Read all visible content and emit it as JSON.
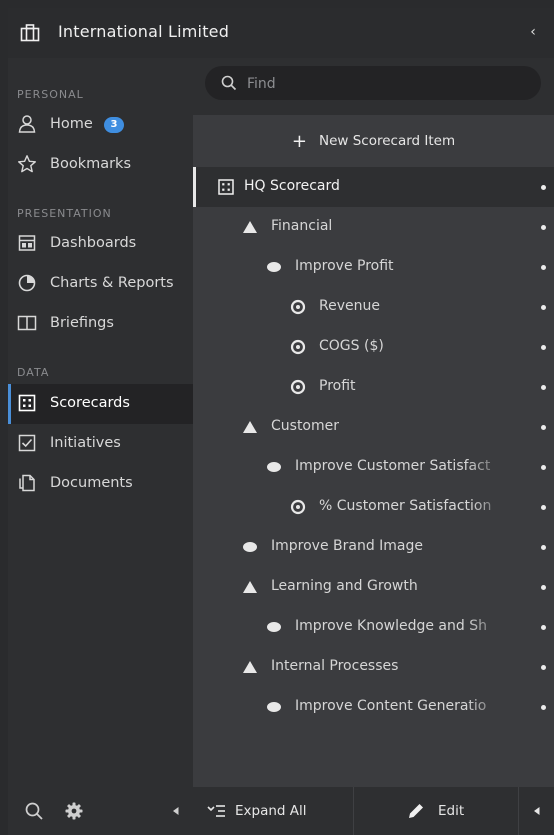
{
  "header": {
    "org_name": "International Limited",
    "org_icon": "briefcase-icon",
    "collapse_icon": "chevron-left-icon"
  },
  "sidebar": {
    "sections": [
      {
        "label": "PERSONAL"
      },
      {
        "label": "PRESENTATION"
      },
      {
        "label": "DATA"
      }
    ],
    "items": [
      {
        "label": "Home",
        "icon": "home-icon",
        "badge": "3"
      },
      {
        "label": "Bookmarks",
        "icon": "star-icon"
      },
      {
        "label": "Dashboards",
        "icon": "dashboard-icon"
      },
      {
        "label": "Charts & Reports",
        "icon": "pie-chart-icon"
      },
      {
        "label": "Briefings",
        "icon": "book-icon"
      },
      {
        "label": "Scorecards",
        "icon": "scorecard-icon",
        "active": true
      },
      {
        "label": "Initiatives",
        "icon": "checkbox-icon"
      },
      {
        "label": "Documents",
        "icon": "documents-icon"
      }
    ],
    "footer": {
      "search_icon": "search-icon",
      "settings_icon": "gear-icon",
      "collapse_icon": "triangle-left-icon"
    }
  },
  "main": {
    "search": {
      "placeholder": "Find"
    },
    "new_item_label": "New Scorecard Item",
    "tree": [
      {
        "label": "HQ Scorecard",
        "icon": "scorecard-icon",
        "level": 0
      },
      {
        "label": "Financial",
        "icon": "triangle-icon",
        "level": 1
      },
      {
        "label": "Improve Profit",
        "icon": "ellipse-icon",
        "level": 2
      },
      {
        "label": "Revenue",
        "icon": "target-icon",
        "level": 3
      },
      {
        "label": "COGS ($)",
        "icon": "target-icon",
        "level": 3
      },
      {
        "label": "Profit",
        "icon": "target-icon",
        "level": 3
      },
      {
        "label": "Customer",
        "icon": "triangle-icon",
        "level": 1
      },
      {
        "label": "Improve Customer Satisfact",
        "icon": "ellipse-icon",
        "level": 2
      },
      {
        "label": "% Customer Satisfaction",
        "icon": "target-icon",
        "level": 3
      },
      {
        "label": "Improve Brand Image",
        "icon": "ellipse-icon",
        "level": 1
      },
      {
        "label": "Learning and Growth",
        "icon": "triangle-icon",
        "level": 1
      },
      {
        "label": "Improve Knowledge and Sh",
        "icon": "ellipse-icon",
        "level": 2
      },
      {
        "label": "Internal Processes",
        "icon": "triangle-icon",
        "level": 1
      },
      {
        "label": "Improve Content Generatio",
        "icon": "ellipse-icon",
        "level": 2
      }
    ],
    "footer": {
      "expand_label": "Expand All",
      "edit_label": "Edit"
    }
  },
  "colors": {
    "accent": "#3f8ee0",
    "sidebar_bg": "#2e2f31",
    "main_bg": "#3b3c3f",
    "header_bg": "#2b2c2e"
  }
}
